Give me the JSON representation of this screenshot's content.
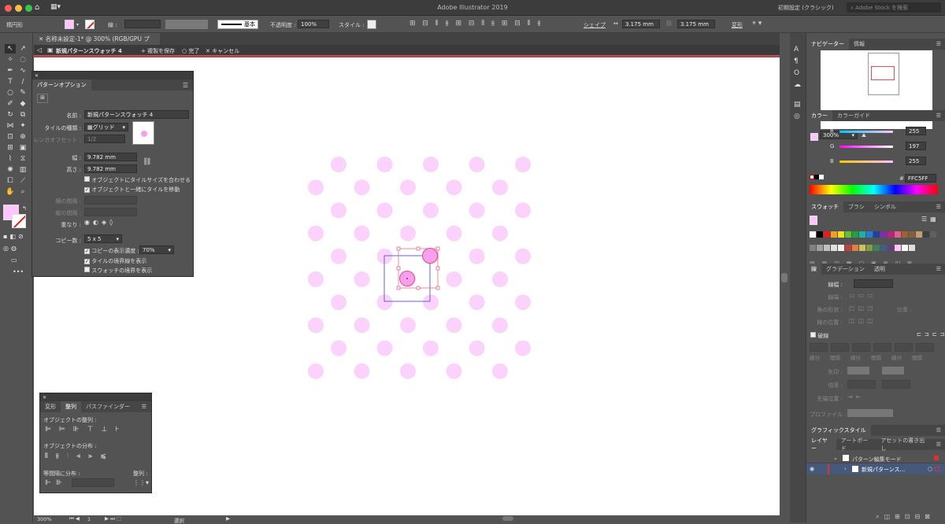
{
  "app": {
    "title": "Adobe Illustrator 2019",
    "workspace": "初期設定 (クラシック)",
    "stock_search": "Adobe Stock を検索"
  },
  "control": {
    "shape": "楕円形",
    "stroke_label": "線 :",
    "brush": "基本",
    "opacity_label": "不透明度 :",
    "opacity": "100%",
    "style_label": "スタイル :",
    "shape_link": "シェイプ",
    "w": "3.175 mm",
    "h": "3.175 mm",
    "transform": "変形"
  },
  "document": {
    "tab": "名称未設定-1* @ 300% (RGB/GPU プレビュー)"
  },
  "isolation": {
    "name": "新規パターンスウォッチ 4",
    "save_copy": "+ 複製を保存",
    "done": "完了",
    "cancel": "キャンセル"
  },
  "pattern_options": {
    "title": "パターンオプション",
    "name_label": "名前 :",
    "name": "新規パターンスウォッチ 4",
    "tile_label": "タイルの種類 :",
    "tile": "グリッド",
    "brick_label": "レンガオフセット :",
    "brick": "1/2",
    "w_label": "幅 :",
    "w": "9.782 mm",
    "h_label": "高さ :",
    "h": "9.782 mm",
    "opt1": "オブジェクトにタイルサイズを合わせる",
    "opt2": "オブジェクトと一緒にタイルを移動",
    "hspace_label": "横の間隔 :",
    "vspace_label": "縦の間隔 :",
    "overlap_label": "重なり :",
    "copies_label": "コピー数 :",
    "copies": "5 x 5",
    "dim_label": "コピーの表示濃度 :",
    "dim": "70%",
    "show_tile": "タイルの境界線を表示",
    "show_swatch": "スウォッチの境界を表示"
  },
  "align_panel": {
    "tabs": [
      "変形",
      "整列",
      "パスファインダー"
    ],
    "align_objects": "オブジェクトの整列 :",
    "distribute_objects": "オブジェクトの分布 :",
    "distribute_spacing": "等間隔に分布 :",
    "align_to": "整列 :"
  },
  "navigator": {
    "tabs": [
      "ナビゲーター",
      "情報"
    ],
    "zoom": "300%"
  },
  "color": {
    "tabs": [
      "カラー",
      "カラーガイド"
    ],
    "r": "255",
    "g": "197",
    "b": "255",
    "hex": "FFC5FF",
    "fill": "#FFC5FF"
  },
  "swatches": {
    "tabs": [
      "スウォッチ",
      "ブラシ",
      "シンボル"
    ]
  },
  "stroke": {
    "tabs": [
      "線",
      "グラデーション",
      "透明"
    ],
    "weight_label": "線幅 :",
    "cap_label": "線端 :",
    "corner_label": "角の形状 :",
    "limit_label": "比率 :",
    "align_label": "線の位置 :",
    "dashed": "破線",
    "dash_labels": [
      "線分",
      "間隔",
      "線分",
      "間隔",
      "線分",
      "間隔"
    ],
    "arrow_label": "矢印 :",
    "scale_label": "倍率 :",
    "arrow_pos_label": "先端位置 :",
    "profile_label": "プロファイル :"
  },
  "graphic_styles": {
    "title": "グラフィックスタイル"
  },
  "layers": {
    "tabs": [
      "レイヤー",
      "アートボード",
      "アセットの書き出し"
    ],
    "items": [
      "パターン編集モード",
      "新規パターンス..."
    ]
  },
  "status": {
    "zoom": "300%",
    "artboard": "1",
    "tool": "選択"
  }
}
